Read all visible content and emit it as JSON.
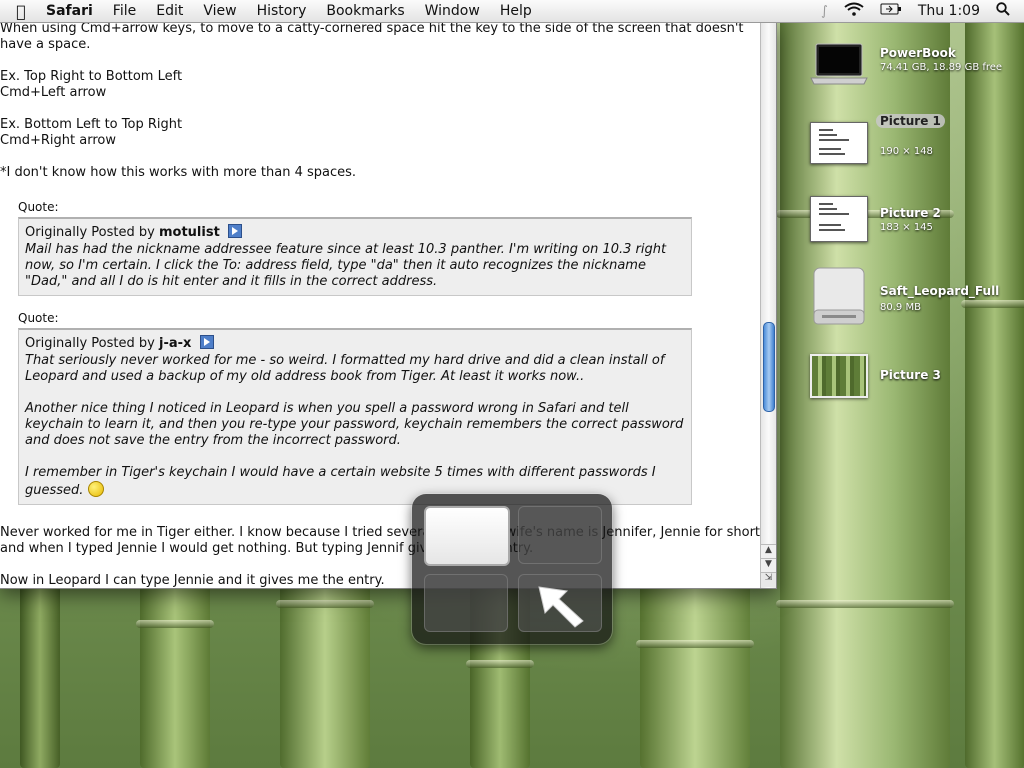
{
  "menubar": {
    "app": "Safari",
    "items": [
      "File",
      "Edit",
      "View",
      "History",
      "Bookmarks",
      "Window",
      "Help"
    ],
    "clock": "Thu 1:09"
  },
  "post": {
    "top_paragraph": "When using Cmd+arrow keys, to move to a catty-cornered space hit the key to the side of the screen that doesn't have a space.",
    "example1": "Ex. Top Right to Bottom Left\nCmd+Left arrow",
    "example2": "Ex. Bottom Left to Top Right\nCmd+Right arrow",
    "note": "*I don't know how this works with more than 4 spaces.",
    "quote1": {
      "label": "Quote:",
      "prefix": "Originally Posted by",
      "author": "motulist",
      "text": "Mail has had the nickname addressee feature since at least 10.3 panther. I'm writing on 10.3 right now, so I'm certain. I click the To: address field, type \"da\" then it auto recognizes the nickname \"Dad,\" and all I do is hit enter and it fills in the correct address."
    },
    "quote2": {
      "label": "Quote:",
      "prefix": "Originally Posted by",
      "author": "j-a-x",
      "text_a": "That seriously never worked for me - so weird. I formatted my hard drive and did a clean install of Leopard and used a backup of my old address book from Tiger. At least it works now..",
      "text_b": "Another nice thing I noticed in Leopard is when you spell a password wrong in Safari and tell keychain to learn it, and then you re-type your password, keychain remembers the correct password and does not save the entry from the incorrect password.",
      "text_c": "I remember in Tiger's keychain I would have a certain website 5 times with different passwords I guessed."
    },
    "reply1": "Never worked for me in Tiger either. I know because I tried several times. My wife's name is Jennifer, Jennie for short and when I typed Jennie I would get nothing. But typing Jennif gives me the entry.",
    "reply2": "Now in Leopard I can type Jennie and it gives me the entry."
  },
  "desktop_icons": [
    {
      "name": "PowerBook",
      "info": "74.41 GB, 18.89 GB free",
      "icon": "laptop-icon"
    },
    {
      "name": "Picture 1",
      "info": "190 × 148",
      "icon": "screenshot-icon",
      "selected": true
    },
    {
      "name": "Picture 2",
      "info": "183 × 145",
      "icon": "screenshot-icon"
    },
    {
      "name": "Saft_Leopard_Full",
      "info": "80.9 MB",
      "icon": "disk-image-icon"
    },
    {
      "name": "Picture 3",
      "info": "",
      "icon": "bamboo-picture-icon"
    }
  ],
  "spaces": {
    "count": 4,
    "active": 1,
    "target": 4
  },
  "colors": {
    "selection": "#3875d7",
    "scroll_thumb": "#4d8ed9",
    "quote_bg": "#eeeeee"
  }
}
